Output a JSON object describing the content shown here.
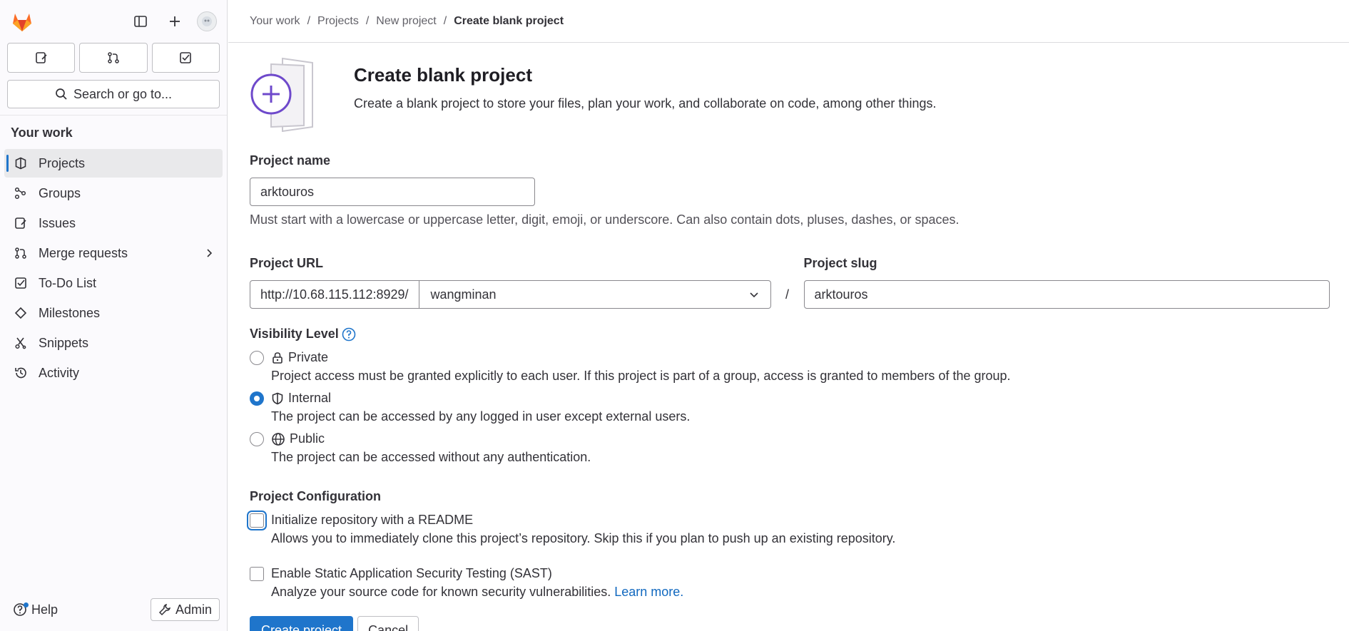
{
  "sidebar": {
    "search_label": "Search or go to...",
    "section_title": "Your work",
    "items": [
      {
        "label": "Projects",
        "icon": "project-icon"
      },
      {
        "label": "Groups",
        "icon": "group-icon"
      },
      {
        "label": "Issues",
        "icon": "issues-icon"
      },
      {
        "label": "Merge requests",
        "icon": "merge-request-icon"
      },
      {
        "label": "To-Do List",
        "icon": "todo-icon"
      },
      {
        "label": "Milestones",
        "icon": "milestone-icon"
      },
      {
        "label": "Snippets",
        "icon": "snippet-icon"
      },
      {
        "label": "Activity",
        "icon": "history-icon"
      }
    ],
    "help_label": "Help",
    "admin_label": "Admin"
  },
  "breadcrumb": [
    "Your work",
    "Projects",
    "New project",
    "Create blank project"
  ],
  "page": {
    "title": "Create blank project",
    "description": "Create a blank project to store your files, plan your work, and collaborate on code, among other things."
  },
  "form": {
    "project_name_label": "Project name",
    "project_name_value": "arktouros",
    "project_name_help": "Must start with a lowercase or uppercase letter, digit, emoji, or underscore. Can also contain dots, pluses, dashes, or spaces.",
    "project_url_label": "Project URL",
    "project_url_prefix": "http://10.68.115.112:8929/",
    "namespace_value": "wangminan",
    "slash": "/",
    "project_slug_label": "Project slug",
    "project_slug_value": "arktouros",
    "visibility_label": "Visibility Level",
    "visibility_options": [
      {
        "label": "Private",
        "desc": "Project access must be granted explicitly to each user. If this project is part of a group, access is granted to members of the group.",
        "checked": false
      },
      {
        "label": "Internal",
        "desc": "The project can be accessed by any logged in user except external users.",
        "checked": true
      },
      {
        "label": "Public",
        "desc": "The project can be accessed without any authentication.",
        "checked": false
      }
    ],
    "config_label": "Project Configuration",
    "readme_label": "Initialize repository with a README",
    "readme_desc": "Allows you to immediately clone this project’s repository. Skip this if you plan to push up an existing repository.",
    "sast_label": "Enable Static Application Security Testing (SAST)",
    "sast_desc": "Analyze your source code for known security vulnerabilities.",
    "sast_link": "Learn more.",
    "create_button": "Create project",
    "cancel_button": "Cancel"
  },
  "colors": {
    "accent": "#1f75cb",
    "brand_orange": "#fc6d26",
    "illustration_purple": "#6e49cb"
  }
}
